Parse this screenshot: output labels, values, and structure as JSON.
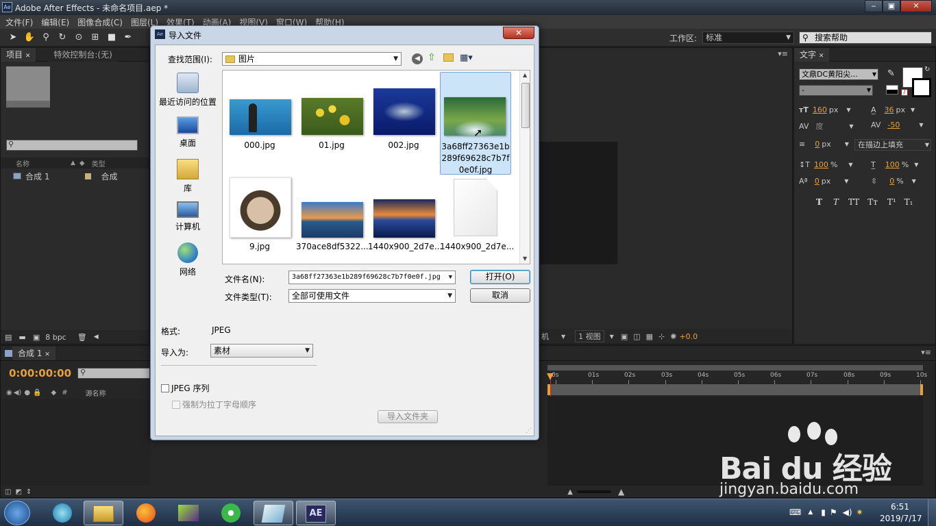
{
  "app": {
    "title": "Adobe After Effects - 未命名项目.aep *",
    "icon": "Ae"
  },
  "menu": [
    "文件(F)",
    "编辑(E)",
    "图像合成(C)",
    "图层(L)",
    "效果(T)",
    "动画(A)",
    "视图(V)",
    "窗口(W)",
    "帮助(H)"
  ],
  "workspace": {
    "label": "工作区:",
    "value": "标准"
  },
  "search_help": {
    "placeholder": "搜索帮助"
  },
  "project_panel": {
    "tab_project": "项目",
    "tab_effects": "特效控制台:(无)",
    "col_name": "名称",
    "col_type": "类型",
    "items": [
      {
        "name": "合成 1",
        "type": "合成"
      }
    ],
    "bpc": "8 bpc"
  },
  "text_panel": {
    "tab": "文字",
    "font": "文鼎DC黄阳尖...",
    "style": "-",
    "size": "160",
    "size_unit": "px",
    "leading": "36",
    "leading_unit": "px",
    "kerning": "度",
    "tracking": "-50",
    "stroke": "0",
    "stroke_unit": "px",
    "stroke_mode": "在描边上填充",
    "vscale": "100",
    "hscale": "100",
    "pct": "%",
    "baseline": "0",
    "baseline_unit": "px",
    "tsume": "0",
    "style_buttons": [
      "T",
      "T",
      "TT",
      "Tт",
      "T¹",
      "T₁"
    ]
  },
  "viewer_bar": {
    "camera": "机",
    "views": "1 视图",
    "exposure": "+0.0"
  },
  "timeline": {
    "tab": "合成 1",
    "timecode": "0:00:00:00",
    "col_source": "源名称",
    "col_num": "#",
    "ticks": [
      "0s",
      "01s",
      "02s",
      "03s",
      "04s",
      "05s",
      "06s",
      "07s",
      "08s",
      "09s",
      "10s"
    ]
  },
  "dialog": {
    "title": "导入文件",
    "lookin_label": "查找范围(I):",
    "lookin_value": "图片",
    "places": [
      "最近访问的位置",
      "桌面",
      "库",
      "计算机",
      "网络"
    ],
    "files": [
      {
        "name": "000.jpg",
        "icon": "person-image"
      },
      {
        "name": "01.jpg",
        "icon": "flower-image"
      },
      {
        "name": "002.jpg",
        "icon": "fish-image"
      },
      {
        "name": "3a68ff27363e1b289f69628c7b7f0e0f.jpg",
        "icon": "forest-image",
        "selected": true
      },
      {
        "name": "9.jpg",
        "icon": "puzzle-face-image"
      },
      {
        "name": "370ace8df5322...",
        "icon": "mountain-lake-image"
      },
      {
        "name": "1440x900_2d7e...",
        "icon": "sunset-sea-image"
      },
      {
        "name": "1440x900_2d7e...",
        "icon": "blank-file-image"
      }
    ],
    "filename_label": "文件名(N):",
    "filename_value": "3a68ff27363e1b289f69628c7b7f0e0f.jpg",
    "filetype_label": "文件类型(T):",
    "filetype_value": "全部可使用文件",
    "open_button": "打开(O)",
    "cancel_button": "取消",
    "format_label": "格式:",
    "format_value": "JPEG",
    "import_as_label": "导入为:",
    "import_as_value": "素材",
    "jpeg_sequence": "JPEG 序列",
    "force_alpha": "强制为拉丁字母顺序",
    "import_folder": "导入文件夹"
  },
  "taskbar": {
    "time": "6:51",
    "date": "2019/7/17",
    "ae_label": "AE"
  },
  "watermark": {
    "logo": "Bai du 经验",
    "url": "jingyan.baidu.com"
  },
  "colors": {
    "accent": "#e8a03a",
    "selection": "#cce4f7",
    "timeline_red": "#d02020"
  }
}
